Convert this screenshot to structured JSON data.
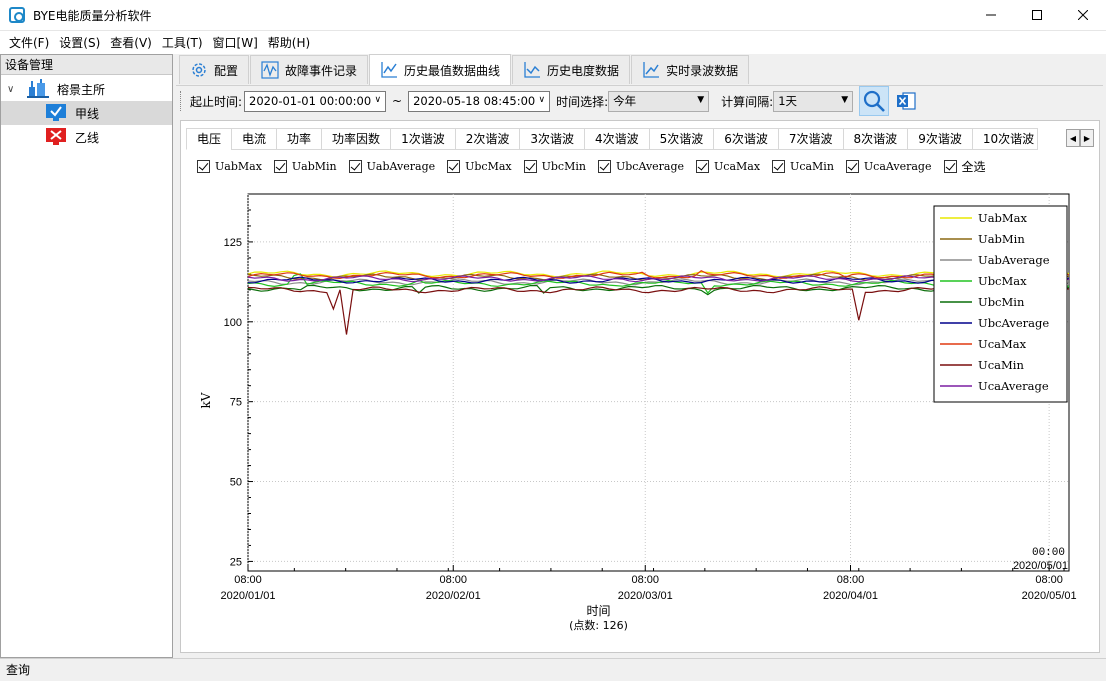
{
  "window": {
    "title": "BYE电能质量分析软件"
  },
  "menu": [
    "文件(F)",
    "设置(S)",
    "查看(V)",
    "工具(T)",
    "窗口[W]",
    "帮助(H)"
  ],
  "sidebar": {
    "header": "设备管理",
    "root": "榕景主所",
    "children": [
      {
        "label": "甲线",
        "status": "ok",
        "color": "#1e7fd8"
      },
      {
        "label": "乙线",
        "status": "error",
        "color": "#e02020"
      }
    ]
  },
  "top_tabs": [
    {
      "label": "配置",
      "icon": "gear-icon"
    },
    {
      "label": "故障事件记录",
      "icon": "waveform-icon"
    },
    {
      "label": "历史最值数据曲线",
      "icon": "line-chart-icon"
    },
    {
      "label": "历史电度数据",
      "icon": "bar-line-chart-icon"
    },
    {
      "label": "实时录波数据",
      "icon": "trend-icon"
    }
  ],
  "filters": {
    "time_range_label": "起止时间:",
    "start": "2020-01-01 00:00:00",
    "separator": "~",
    "end": "2020-05-18 08:45:00",
    "time_select_label": "时间选择:",
    "time_select_value": "今年",
    "interval_label": "计算间隔:",
    "interval_value": "1天"
  },
  "sub_tabs": [
    "电压",
    "电流",
    "功率",
    "功率因数",
    "1次谐波",
    "2次谐波",
    "3次谐波",
    "4次谐波",
    "5次谐波",
    "6次谐波",
    "7次谐波",
    "8次谐波",
    "9次谐波",
    "10次谐波"
  ],
  "checkboxes": [
    "UabMax",
    "UabMin",
    "UabAverage",
    "UbcMax",
    "UbcMin",
    "UbcAverage",
    "UcaMax",
    "UcaMin",
    "UcaAverage",
    "全选"
  ],
  "status_bar": "查询",
  "chart_data": {
    "type": "line",
    "ylabel": "kV",
    "xlabel": "时间",
    "x_note": "(点数: 126)",
    "ylim": [
      22,
      140
    ],
    "y_ticks": [
      25,
      50,
      75,
      100,
      125
    ],
    "x_ticks": [
      {
        "time": "08:00",
        "date": "2020/01/01",
        "day": 0
      },
      {
        "time": "08:00",
        "date": "2020/02/01",
        "day": 31
      },
      {
        "time": "08:00",
        "date": "2020/03/01",
        "day": 60
      },
      {
        "time": "08:00",
        "date": "2020/04/01",
        "day": 91
      },
      {
        "time": "08:00",
        "date": "2020/05/01",
        "day": 121
      }
    ],
    "corner_label": {
      "time": "00:00",
      "date": "2020/05/01"
    },
    "xlim": [
      0,
      124
    ],
    "grid": true,
    "legend_position": "top-right",
    "series": [
      {
        "name": "UabMax",
        "color": "#e8e800",
        "base": 115,
        "dips": []
      },
      {
        "name": "UabMin",
        "color": "#8b6914",
        "base": 114,
        "dips": []
      },
      {
        "name": "UabAverage",
        "color": "#8c8c8c",
        "base": 112.5,
        "dips": []
      },
      {
        "name": "UbcMax",
        "color": "#22c322",
        "base": 112,
        "dips": [
          [
            7,
            114.5
          ],
          [
            8,
            115
          ],
          [
            26,
            113
          ],
          [
            55,
            111.5
          ],
          [
            64,
            112.5
          ],
          [
            69,
            109
          ]
        ]
      },
      {
        "name": "UbcMin",
        "color": "#0a6e0a",
        "base": 110.5,
        "dips": [
          [
            8,
            110
          ],
          [
            26,
            109
          ],
          [
            45,
            109
          ],
          [
            69,
            108.5
          ]
        ]
      },
      {
        "name": "UbcAverage",
        "color": "#00008b",
        "base": 113,
        "dips": []
      },
      {
        "name": "UcaMax",
        "color": "#e03a10",
        "base": 114.5,
        "dips": [
          [
            55,
            115.5
          ],
          [
            60,
            115.5
          ],
          [
            68,
            116
          ],
          [
            90,
            114
          ]
        ]
      },
      {
        "name": "UcaMin",
        "color": "#7a0f0f",
        "base": 110,
        "dips": [
          [
            13,
            104
          ],
          [
            15,
            96
          ],
          [
            92,
            100.5
          ]
        ]
      },
      {
        "name": "UcaAverage",
        "color": "#7b1fa2",
        "base": 113.5,
        "dips": []
      }
    ]
  }
}
